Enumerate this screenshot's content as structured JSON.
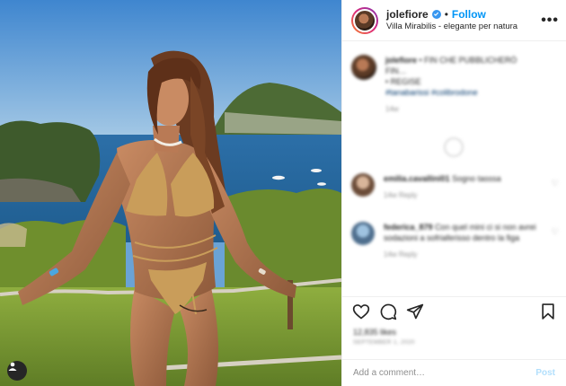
{
  "header": {
    "username": "jolefiore",
    "follow_label": "Follow",
    "dot": "•",
    "location": "Villa Mirabilis - elegante per natura",
    "more": "•••"
  },
  "caption": {
    "username": "jolefiore",
    "text_line1": "• FIN CHE PUBBLICHERÒ",
    "text_line2": "FIN…",
    "text_line3": "• REGISE",
    "text_line4": "#tanabarissi #colibrodone"
  },
  "comments": [
    {
      "username": "emilia.cavallini01",
      "text": "Sogno tasssa",
      "meta": "14w  Reply"
    },
    {
      "username": "federica_879",
      "text": "Con quel mini ci si non avrei sodazioni a sofriaferisso dentro la figa",
      "meta": "14w  Reply"
    }
  ],
  "caption_meta": "14w",
  "likes": "12,835 likes",
  "timestamp": "SEPTEMBER 1, 2020",
  "add_comment": {
    "placeholder": "Add a comment…",
    "post_label": "Post"
  },
  "colors": {
    "accent": "#0095f6",
    "post_disabled": "#b2dffc",
    "muted": "#8e8e8e"
  },
  "icons": [
    "verified-icon",
    "more-options-icon",
    "heart-icon",
    "comment-icon",
    "share-icon",
    "bookmark-icon",
    "user-tag-icon"
  ]
}
